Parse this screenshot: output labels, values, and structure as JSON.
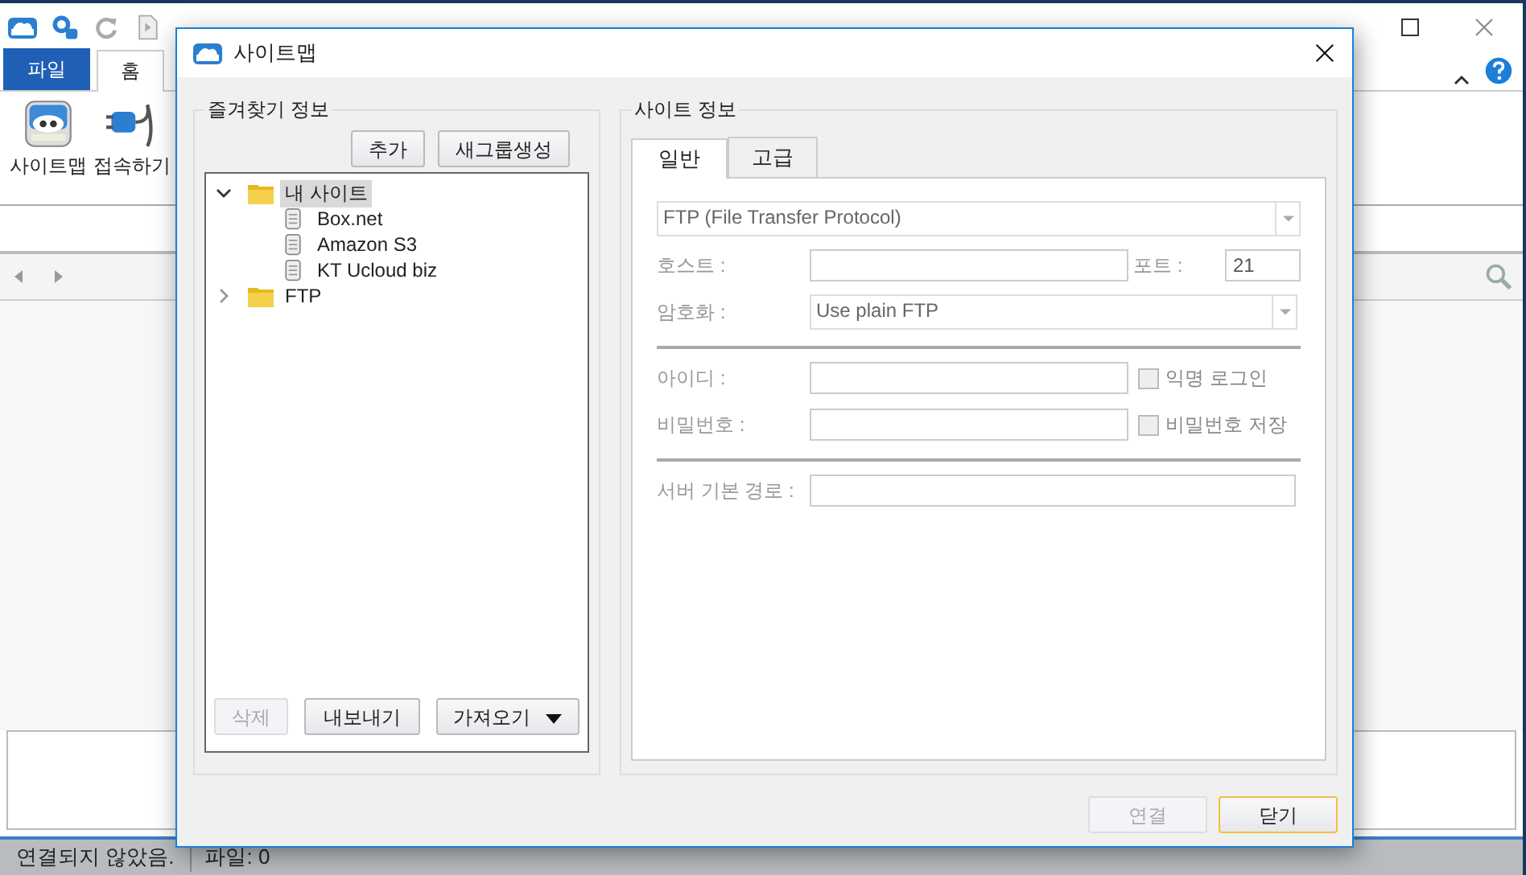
{
  "app": {
    "ribbon_tabs": [
      {
        "label": "파일",
        "kind": "file",
        "selected": false
      },
      {
        "label": "홈",
        "kind": "tab",
        "selected": true
      }
    ],
    "ribbon_buttons": [
      {
        "label": "사이트맵",
        "kind": "sitemap"
      },
      {
        "label": "접속하기",
        "kind": "connect"
      }
    ],
    "status_bar": [
      "연결되지 않았음.",
      "파일: 0"
    ]
  },
  "dialog": {
    "title": "사이트맵",
    "favorites": {
      "title": "즐겨찾기 정보",
      "buttons": [
        "추가",
        "새그룹생성"
      ],
      "tree": [
        {
          "label": "내 사이트",
          "kind": "folder",
          "expanded": true,
          "selected": true,
          "children": [
            {
              "label": "Box.net",
              "kind": "site",
              "selected": false
            },
            {
              "label": "Amazon S3",
              "kind": "site",
              "selected": false
            },
            {
              "label": "KT Ucloud biz",
              "kind": "site",
              "selected": false
            }
          ]
        },
        {
          "label": "FTP",
          "kind": "folder",
          "expanded": false,
          "selected": false
        }
      ],
      "footer_buttons": [
        {
          "label": "삭제",
          "kind": "button",
          "disabled": true
        },
        {
          "label": "내보내기",
          "kind": "button",
          "disabled": false
        },
        {
          "label": "가져오기",
          "kind": "dropdown",
          "disabled": false
        }
      ]
    },
    "site_info": {
      "title": "사이트 정보",
      "tabs": [
        {
          "label": "일반",
          "selected": true
        },
        {
          "label": "고급",
          "selected": false
        }
      ],
      "protocol": {
        "value": "FTP (File Transfer Protocol)"
      },
      "host": {
        "label": "호스트 :"
      },
      "port": {
        "label": "포트 :",
        "value": "21"
      },
      "encryption": {
        "label": "암호화 :",
        "value": "Use plain FTP"
      },
      "user_id": {
        "label": "아이디 :"
      },
      "anonymous": {
        "label": "익명 로그인",
        "checked": false
      },
      "password": {
        "label": "비밀번호 :"
      },
      "save_password": {
        "label": "비밀번호 저장",
        "checked": false
      },
      "base_path": {
        "label": "서버 기본 경로 :"
      }
    },
    "footer_buttons": [
      {
        "label": "연결",
        "disabled": true,
        "default": false
      },
      {
        "label": "닫기",
        "disabled": false,
        "default": true
      }
    ]
  }
}
